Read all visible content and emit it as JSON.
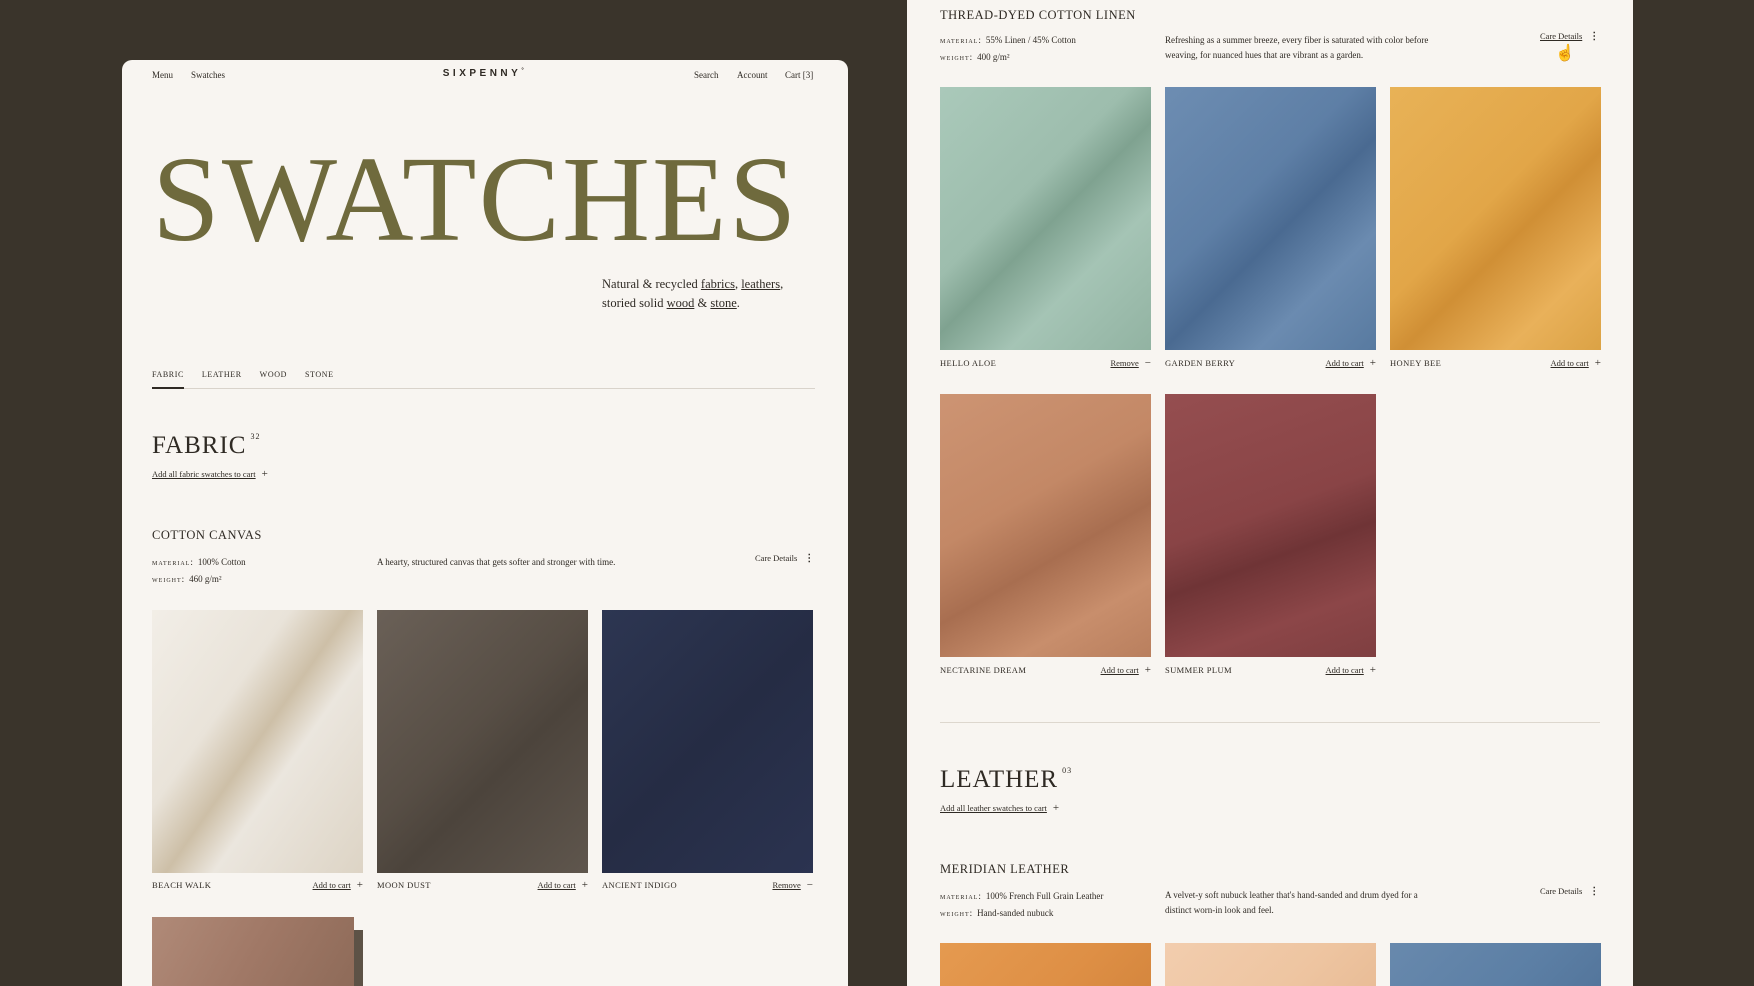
{
  "header": {
    "menu": "Menu",
    "swatches": "Swatches",
    "logo": "SIXPENNY",
    "search": "Search",
    "account": "Account",
    "cart": "Cart [3]"
  },
  "hero": {
    "title": "SWATCHES",
    "intro": {
      "line1_prefix": "Natural & recycled ",
      "fabrics": "fabrics",
      "comma": ", ",
      "leathers": "leathers",
      "comma2": ",",
      "line2_prefix": "storied solid ",
      "wood": "wood",
      "amp": " & ",
      "stone": "stone",
      "period": "."
    }
  },
  "tabs": [
    "FABRIC",
    "LEATHER",
    "WOOD",
    "STONE"
  ],
  "fabric_section": {
    "title": "FABRIC",
    "count": "32",
    "add_all": "Add all fabric swatches to cart"
  },
  "cotton_canvas": {
    "title": "COTTON CANVAS",
    "material_key": "material:",
    "material": "100% Cotton",
    "weight_key": "weight:",
    "weight": "460 g/m²",
    "description": "A hearty, structured canvas that gets softer and stronger with time.",
    "care": "Care Details",
    "swatches": [
      {
        "name": "BEACH WALK",
        "action": "Add to cart",
        "symbol": "+",
        "color": "#e2dacd"
      },
      {
        "name": "MOON DUST",
        "action": "Add to cart",
        "symbol": "+",
        "color": "#5b5249"
      },
      {
        "name": "ANCIENT INDIGO",
        "action": "Remove",
        "symbol": "−",
        "color": "#27304a"
      }
    ]
  },
  "thread_dyed": {
    "title": "THREAD-DYED COTTON LINEN",
    "material_key": "material:",
    "material": "55% Linen / 45% Cotton",
    "weight_key": "weight:",
    "weight": "400 g/m²",
    "description": "Refreshing as a summer breeze, every fiber is saturated with color before weaving, for nuanced hues that are vibrant as a garden.",
    "care": "Care Details",
    "swatches": [
      {
        "name": "HELLO ALOE",
        "action": "Remove",
        "symbol": "−",
        "color": "#9dbdad"
      },
      {
        "name": "GARDEN BERRY",
        "action": "Add to cart",
        "symbol": "+",
        "color": "#5e7fa6"
      },
      {
        "name": "HONEY BEE",
        "action": "Add to cart",
        "symbol": "+",
        "color": "#e2a648"
      },
      {
        "name": "NECTARINE DREAM",
        "action": "Add to cart",
        "symbol": "+",
        "color": "#c38866"
      },
      {
        "name": "SUMMER PLUM",
        "action": "Add to cart",
        "symbol": "+",
        "color": "#894446"
      }
    ]
  },
  "leather_section": {
    "title": "LEATHER",
    "count": "03",
    "add_all": "Add all leather swatches to cart"
  },
  "meridian": {
    "title": "MERIDIAN LEATHER",
    "material_key": "material:",
    "material": "100% French Full Grain Leather",
    "weight_key": "weight:",
    "weight": "Hand-sanded nubuck",
    "description": "A velvet-y soft nubuck leather that's hand-sanded and drum dyed for a distinct worn-in look and feel.",
    "care": "Care Details",
    "swatch_colors": [
      "#de8f45",
      "#eec5a1",
      "#5c7fa5"
    ]
  },
  "extra_swatch_color": "#a67e6c",
  "icons": {
    "plus": "plus-icon",
    "minus": "minus-icon",
    "kebab": "more-vertical-icon",
    "cursor": "hand-cursor-icon"
  }
}
